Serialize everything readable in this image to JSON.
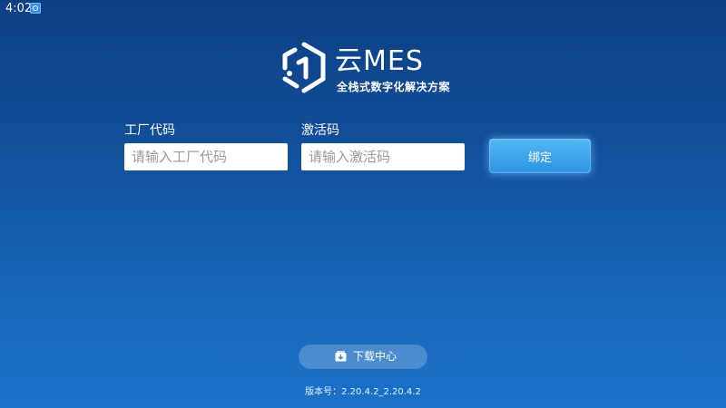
{
  "status_bar": {
    "time": "4:02",
    "app_icon": "app-notification-icon"
  },
  "logo": {
    "mark_icon": "hexagon-logo-icon",
    "title": "云MES",
    "subtitle": "全栈式数字化解决方案"
  },
  "form": {
    "factory_code": {
      "label": "工厂代码",
      "value": "",
      "placeholder": "请输入工厂代码"
    },
    "activation_code": {
      "label": "激活码",
      "value": "",
      "placeholder": "请输入激活码"
    },
    "bind_label": "绑定"
  },
  "footer": {
    "download_label": "下载中心",
    "download_icon": "download-box-icon",
    "version": "版本号：2.20.4.2_2.20.4.2"
  },
  "colors": {
    "background_top": "#0d3f83",
    "background_bottom": "#1b72c9",
    "button_accent": "#2d93e2"
  }
}
